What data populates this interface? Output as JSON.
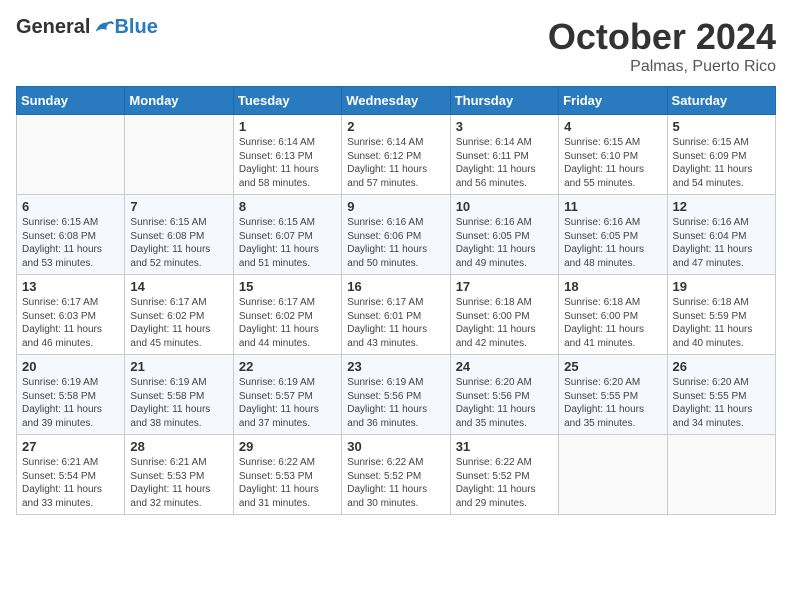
{
  "header": {
    "logo_general": "General",
    "logo_blue": "Blue",
    "month": "October 2024",
    "location": "Palmas, Puerto Rico"
  },
  "days_of_week": [
    "Sunday",
    "Monday",
    "Tuesday",
    "Wednesday",
    "Thursday",
    "Friday",
    "Saturday"
  ],
  "weeks": [
    [
      {
        "day": "",
        "info": ""
      },
      {
        "day": "",
        "info": ""
      },
      {
        "day": "1",
        "info": "Sunrise: 6:14 AM\nSunset: 6:13 PM\nDaylight: 11 hours and 58 minutes."
      },
      {
        "day": "2",
        "info": "Sunrise: 6:14 AM\nSunset: 6:12 PM\nDaylight: 11 hours and 57 minutes."
      },
      {
        "day": "3",
        "info": "Sunrise: 6:14 AM\nSunset: 6:11 PM\nDaylight: 11 hours and 56 minutes."
      },
      {
        "day": "4",
        "info": "Sunrise: 6:15 AM\nSunset: 6:10 PM\nDaylight: 11 hours and 55 minutes."
      },
      {
        "day": "5",
        "info": "Sunrise: 6:15 AM\nSunset: 6:09 PM\nDaylight: 11 hours and 54 minutes."
      }
    ],
    [
      {
        "day": "6",
        "info": "Sunrise: 6:15 AM\nSunset: 6:08 PM\nDaylight: 11 hours and 53 minutes."
      },
      {
        "day": "7",
        "info": "Sunrise: 6:15 AM\nSunset: 6:08 PM\nDaylight: 11 hours and 52 minutes."
      },
      {
        "day": "8",
        "info": "Sunrise: 6:15 AM\nSunset: 6:07 PM\nDaylight: 11 hours and 51 minutes."
      },
      {
        "day": "9",
        "info": "Sunrise: 6:16 AM\nSunset: 6:06 PM\nDaylight: 11 hours and 50 minutes."
      },
      {
        "day": "10",
        "info": "Sunrise: 6:16 AM\nSunset: 6:05 PM\nDaylight: 11 hours and 49 minutes."
      },
      {
        "day": "11",
        "info": "Sunrise: 6:16 AM\nSunset: 6:05 PM\nDaylight: 11 hours and 48 minutes."
      },
      {
        "day": "12",
        "info": "Sunrise: 6:16 AM\nSunset: 6:04 PM\nDaylight: 11 hours and 47 minutes."
      }
    ],
    [
      {
        "day": "13",
        "info": "Sunrise: 6:17 AM\nSunset: 6:03 PM\nDaylight: 11 hours and 46 minutes."
      },
      {
        "day": "14",
        "info": "Sunrise: 6:17 AM\nSunset: 6:02 PM\nDaylight: 11 hours and 45 minutes."
      },
      {
        "day": "15",
        "info": "Sunrise: 6:17 AM\nSunset: 6:02 PM\nDaylight: 11 hours and 44 minutes."
      },
      {
        "day": "16",
        "info": "Sunrise: 6:17 AM\nSunset: 6:01 PM\nDaylight: 11 hours and 43 minutes."
      },
      {
        "day": "17",
        "info": "Sunrise: 6:18 AM\nSunset: 6:00 PM\nDaylight: 11 hours and 42 minutes."
      },
      {
        "day": "18",
        "info": "Sunrise: 6:18 AM\nSunset: 6:00 PM\nDaylight: 11 hours and 41 minutes."
      },
      {
        "day": "19",
        "info": "Sunrise: 6:18 AM\nSunset: 5:59 PM\nDaylight: 11 hours and 40 minutes."
      }
    ],
    [
      {
        "day": "20",
        "info": "Sunrise: 6:19 AM\nSunset: 5:58 PM\nDaylight: 11 hours and 39 minutes."
      },
      {
        "day": "21",
        "info": "Sunrise: 6:19 AM\nSunset: 5:58 PM\nDaylight: 11 hours and 38 minutes."
      },
      {
        "day": "22",
        "info": "Sunrise: 6:19 AM\nSunset: 5:57 PM\nDaylight: 11 hours and 37 minutes."
      },
      {
        "day": "23",
        "info": "Sunrise: 6:19 AM\nSunset: 5:56 PM\nDaylight: 11 hours and 36 minutes."
      },
      {
        "day": "24",
        "info": "Sunrise: 6:20 AM\nSunset: 5:56 PM\nDaylight: 11 hours and 35 minutes."
      },
      {
        "day": "25",
        "info": "Sunrise: 6:20 AM\nSunset: 5:55 PM\nDaylight: 11 hours and 35 minutes."
      },
      {
        "day": "26",
        "info": "Sunrise: 6:20 AM\nSunset: 5:55 PM\nDaylight: 11 hours and 34 minutes."
      }
    ],
    [
      {
        "day": "27",
        "info": "Sunrise: 6:21 AM\nSunset: 5:54 PM\nDaylight: 11 hours and 33 minutes."
      },
      {
        "day": "28",
        "info": "Sunrise: 6:21 AM\nSunset: 5:53 PM\nDaylight: 11 hours and 32 minutes."
      },
      {
        "day": "29",
        "info": "Sunrise: 6:22 AM\nSunset: 5:53 PM\nDaylight: 11 hours and 31 minutes."
      },
      {
        "day": "30",
        "info": "Sunrise: 6:22 AM\nSunset: 5:52 PM\nDaylight: 11 hours and 30 minutes."
      },
      {
        "day": "31",
        "info": "Sunrise: 6:22 AM\nSunset: 5:52 PM\nDaylight: 11 hours and 29 minutes."
      },
      {
        "day": "",
        "info": ""
      },
      {
        "day": "",
        "info": ""
      }
    ]
  ]
}
